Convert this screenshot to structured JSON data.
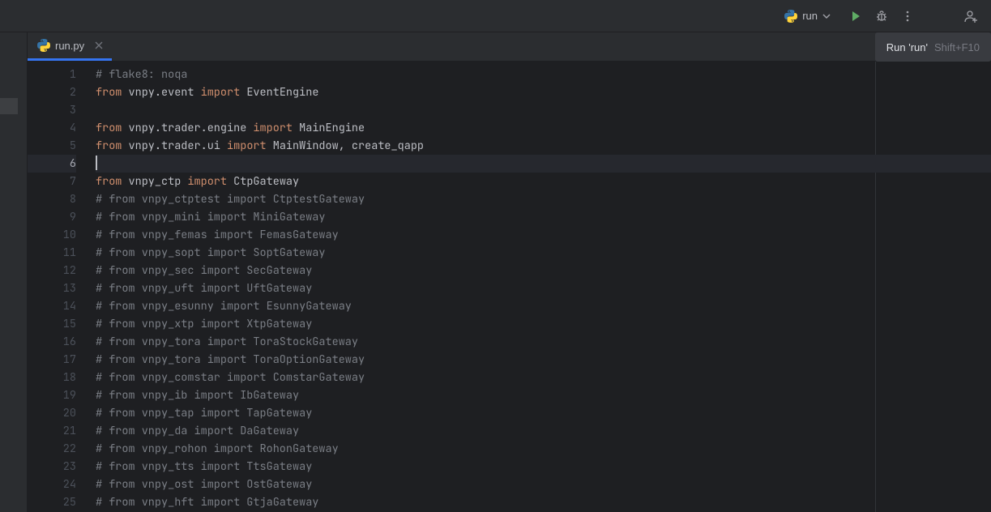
{
  "toolbar": {
    "run_config_label": "run"
  },
  "tab": {
    "filename": "run.py"
  },
  "tooltip": {
    "title": "Run 'run'",
    "shortcut": "Shift+F10"
  },
  "editor": {
    "current_line": 6,
    "lines": [
      {
        "n": 1,
        "tokens": [
          {
            "t": "comment",
            "s": "# flake8: noqa"
          }
        ]
      },
      {
        "n": 2,
        "tokens": [
          {
            "t": "kw",
            "s": "from"
          },
          {
            "t": "txt",
            "s": " vnpy.event "
          },
          {
            "t": "kw",
            "s": "import"
          },
          {
            "t": "txt",
            "s": " EventEngine"
          }
        ]
      },
      {
        "n": 3,
        "tokens": []
      },
      {
        "n": 4,
        "tokens": [
          {
            "t": "kw",
            "s": "from"
          },
          {
            "t": "txt",
            "s": " vnpy.trader.engine "
          },
          {
            "t": "kw",
            "s": "import"
          },
          {
            "t": "txt",
            "s": " MainEngine"
          }
        ]
      },
      {
        "n": 5,
        "tokens": [
          {
            "t": "kw",
            "s": "from"
          },
          {
            "t": "txt",
            "s": " vnpy.trader.ui "
          },
          {
            "t": "kw",
            "s": "import"
          },
          {
            "t": "txt",
            "s": " MainWindow, create_qapp"
          }
        ]
      },
      {
        "n": 6,
        "tokens": [],
        "current": true
      },
      {
        "n": 7,
        "tokens": [
          {
            "t": "kw",
            "s": "from"
          },
          {
            "t": "txt",
            "s": " vnpy_ctp "
          },
          {
            "t": "kw",
            "s": "import"
          },
          {
            "t": "txt",
            "s": " CtpGateway"
          }
        ]
      },
      {
        "n": 8,
        "tokens": [
          {
            "t": "comment",
            "s": "# from vnpy_ctptest import CtptestGateway"
          }
        ]
      },
      {
        "n": 9,
        "tokens": [
          {
            "t": "comment",
            "s": "# from vnpy_mini import MiniGateway"
          }
        ]
      },
      {
        "n": 10,
        "tokens": [
          {
            "t": "comment",
            "s": "# from vnpy_femas import FemasGateway"
          }
        ]
      },
      {
        "n": 11,
        "tokens": [
          {
            "t": "comment",
            "s": "# from vnpy_sopt import SoptGateway"
          }
        ]
      },
      {
        "n": 12,
        "tokens": [
          {
            "t": "comment",
            "s": "# from vnpy_sec import SecGateway"
          }
        ]
      },
      {
        "n": 13,
        "tokens": [
          {
            "t": "comment",
            "s": "# from vnpy_uft import UftGateway"
          }
        ]
      },
      {
        "n": 14,
        "tokens": [
          {
            "t": "comment",
            "s": "# from vnpy_esunny import EsunnyGateway"
          }
        ]
      },
      {
        "n": 15,
        "tokens": [
          {
            "t": "comment",
            "s": "# from vnpy_xtp import XtpGateway"
          }
        ]
      },
      {
        "n": 16,
        "tokens": [
          {
            "t": "comment",
            "s": "# from vnpy_tora import ToraStockGateway"
          }
        ]
      },
      {
        "n": 17,
        "tokens": [
          {
            "t": "comment",
            "s": "# from vnpy_tora import ToraOptionGateway"
          }
        ]
      },
      {
        "n": 18,
        "tokens": [
          {
            "t": "comment",
            "s": "# from vnpy_comstar import ComstarGateway"
          }
        ]
      },
      {
        "n": 19,
        "tokens": [
          {
            "t": "comment",
            "s": "# from vnpy_ib import IbGateway"
          }
        ]
      },
      {
        "n": 20,
        "tokens": [
          {
            "t": "comment",
            "s": "# from vnpy_tap import TapGateway"
          }
        ]
      },
      {
        "n": 21,
        "tokens": [
          {
            "t": "comment",
            "s": "# from vnpy_da import DaGateway"
          }
        ]
      },
      {
        "n": 22,
        "tokens": [
          {
            "t": "comment",
            "s": "# from vnpy_rohon import RohonGateway"
          }
        ]
      },
      {
        "n": 23,
        "tokens": [
          {
            "t": "comment",
            "s": "# from vnpy_tts import TtsGateway"
          }
        ]
      },
      {
        "n": 24,
        "tokens": [
          {
            "t": "comment",
            "s": "# from vnpy_ost import OstGateway"
          }
        ]
      },
      {
        "n": 25,
        "tokens": [
          {
            "t": "comment",
            "s": "# from vnpy_hft import GtjaGateway"
          }
        ]
      }
    ]
  }
}
